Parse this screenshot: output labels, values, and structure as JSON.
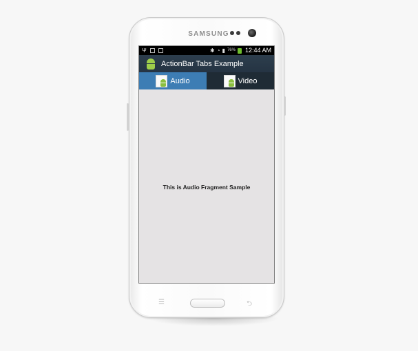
{
  "device": {
    "brand": "SAMSUNG"
  },
  "statusbar": {
    "battery_percent": "76%",
    "time": "12:44 AM"
  },
  "actionbar": {
    "title": "ActionBar Tabs Example"
  },
  "tabs": [
    {
      "label": "Audio",
      "selected": true
    },
    {
      "label": "Video",
      "selected": false
    }
  ],
  "fragment": {
    "text": "This is Audio Fragment Sample"
  },
  "colors": {
    "actionbar": "#2d3e4d",
    "tab_selected": "#3d7db4",
    "tab_bar": "#1f2b35",
    "content_bg": "#e5e3e4",
    "android_green": "#9fce4a"
  },
  "icons": {
    "menu_key": "menu-icon",
    "back_key": "back-icon"
  }
}
